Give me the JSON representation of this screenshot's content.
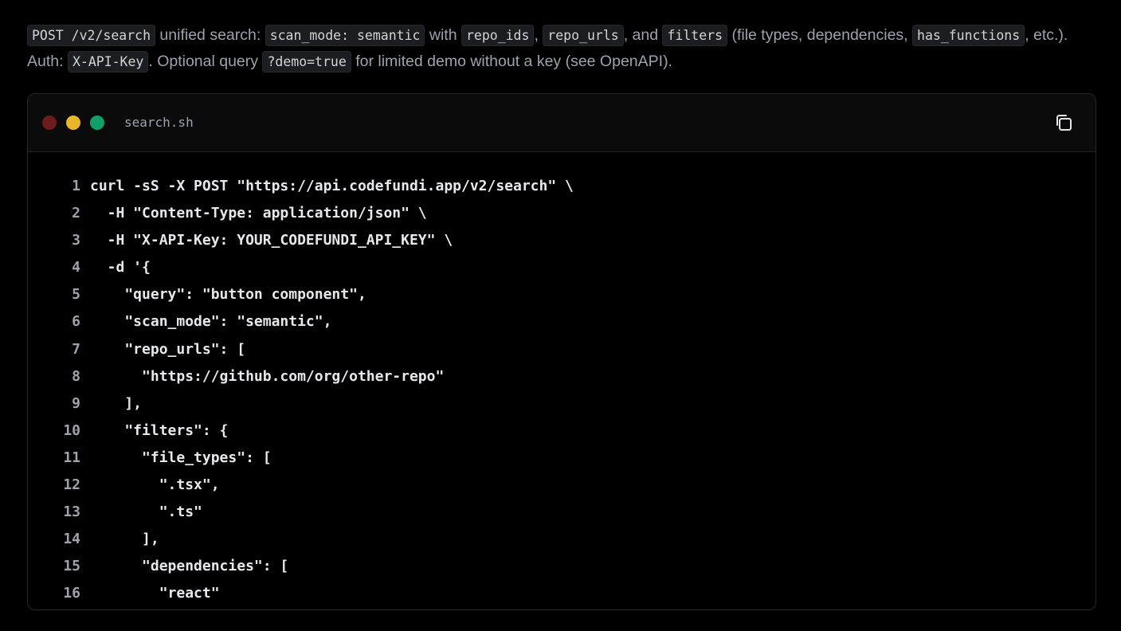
{
  "intro": {
    "parts": [
      {
        "type": "code",
        "text": "POST /v2/search"
      },
      {
        "type": "text",
        "text": " unified search: "
      },
      {
        "type": "code",
        "text": "scan_mode: semantic"
      },
      {
        "type": "text",
        "text": " with "
      },
      {
        "type": "code",
        "text": "repo_ids"
      },
      {
        "type": "text",
        "text": ", "
      },
      {
        "type": "code",
        "text": "repo_urls"
      },
      {
        "type": "text",
        "text": ", and "
      },
      {
        "type": "code",
        "text": "filters"
      },
      {
        "type": "text",
        "text": " (file types, dependencies, "
      },
      {
        "type": "code",
        "text": "has_functions"
      },
      {
        "type": "text",
        "text": ", etc.). Auth: "
      },
      {
        "type": "code",
        "text": "X-API-Key"
      },
      {
        "type": "text",
        "text": ". Optional query "
      },
      {
        "type": "code",
        "text": "?demo=true"
      },
      {
        "type": "text",
        "text": " for limited demo without a key (see OpenAPI)."
      }
    ]
  },
  "code_window": {
    "filename": "search.sh",
    "copy_icon": "copy-icon",
    "traffic_lights": {
      "red": "#6e1b1b",
      "yellow": "#e8b429",
      "green": "#12a06a"
    },
    "lines": [
      {
        "num": "1",
        "text": "curl -sS -X POST \"https://api.codefundi.app/v2/search\" \\"
      },
      {
        "num": "2",
        "text": "  -H \"Content-Type: application/json\" \\"
      },
      {
        "num": "3",
        "text": "  -H \"X-API-Key: YOUR_CODEFUNDI_API_KEY\" \\"
      },
      {
        "num": "4",
        "text": "  -d '{"
      },
      {
        "num": "5",
        "text": "    \"query\": \"button component\","
      },
      {
        "num": "6",
        "text": "    \"scan_mode\": \"semantic\","
      },
      {
        "num": "7",
        "text": "    \"repo_urls\": ["
      },
      {
        "num": "8",
        "text": "      \"https://github.com/org/other-repo\""
      },
      {
        "num": "9",
        "text": "    ],"
      },
      {
        "num": "10",
        "text": "    \"filters\": {"
      },
      {
        "num": "11",
        "text": "      \"file_types\": ["
      },
      {
        "num": "12",
        "text": "        \".tsx\","
      },
      {
        "num": "13",
        "text": "        \".ts\""
      },
      {
        "num": "14",
        "text": "      ],"
      },
      {
        "num": "15",
        "text": "      \"dependencies\": ["
      },
      {
        "num": "16",
        "text": "        \"react\""
      }
    ]
  }
}
